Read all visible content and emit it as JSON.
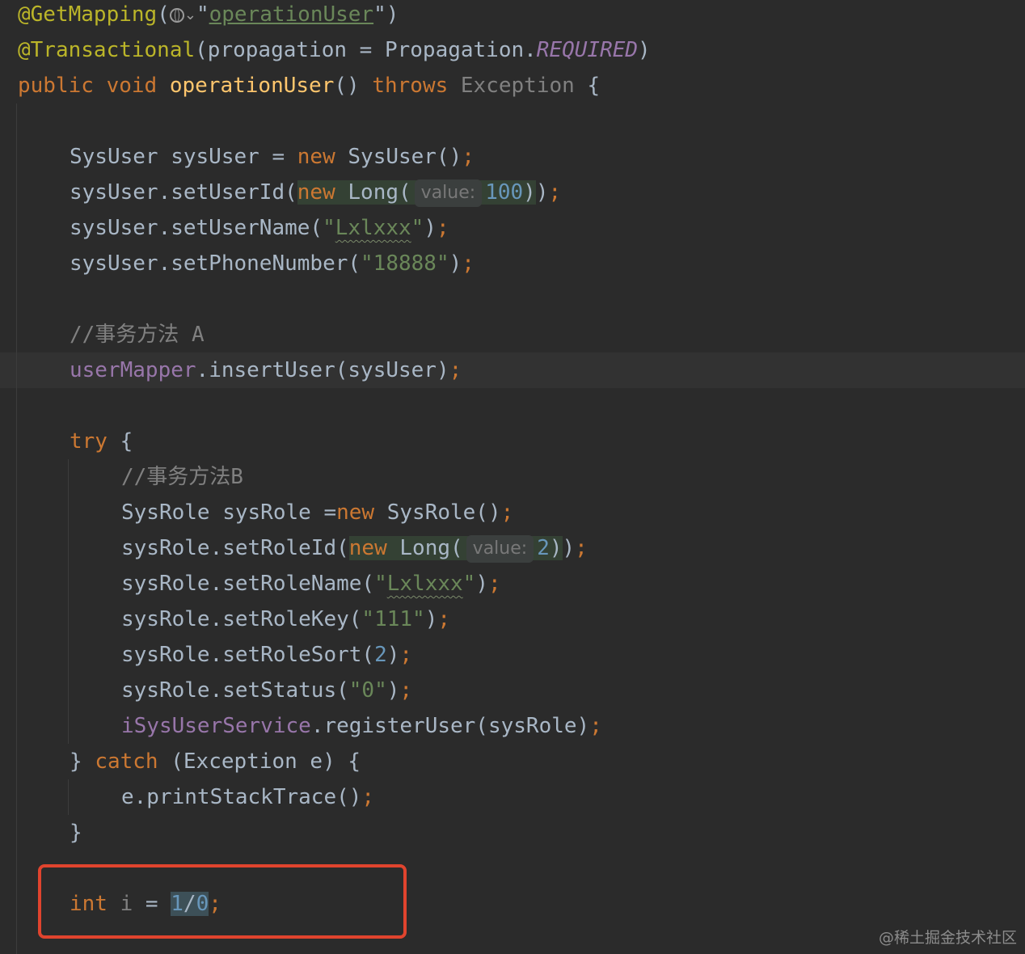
{
  "code": {
    "get_mapping_annotation": "@GetMapping",
    "get_mapping_path": "operationUser",
    "transactional_annotation": "@Transactional",
    "transactional_args": "(propagation = Propagation.",
    "required_constant": "REQUIRED",
    "kw_public": "public",
    "kw_void": "void",
    "method_name": "operationUser",
    "kw_throws": "throws",
    "exception_type": "Exception",
    "sysuser_decl": "SysUser sysUser = ",
    "kw_new": "new",
    "sysuser_ctor": "SysUser()",
    "set_user_id": "sysUser.setUserId(",
    "long_ctor": "Long(",
    "hint_value": "value:",
    "user_id_value": "100",
    "set_user_name": "sysUser.setUserName(",
    "user_name_value": "Lxlxxx",
    "set_phone": "sysUser.setPhoneNumber(",
    "phone_value": "\"18888\"",
    "comment_a": "//事务方法 A",
    "user_mapper": "userMapper",
    "insert_user_call": ".insertUser(sysUser)",
    "kw_try": "try",
    "comment_b": "//事务方法B",
    "sysrole_decl": "SysRole sysRole =",
    "sysrole_ctor": "SysRole()",
    "set_role_id": "sysRole.setRoleId(",
    "role_id_value": "2",
    "set_role_name": "sysRole.setRoleName(",
    "role_name_value": "Lxlxxx",
    "set_role_key": "sysRole.setRoleKey(",
    "role_key_value": "\"111\"",
    "set_role_sort": "sysRole.setRoleSort(",
    "role_sort_value": "2",
    "set_status": "sysRole.setStatus(",
    "status_value": "\"0\"",
    "service_field": "iSysUserService",
    "register_call": ".registerUser(sysRole)",
    "kw_catch": "catch",
    "catch_args": "(Exception e) {",
    "print_stack": "e.printStackTrace()",
    "kw_int": "int",
    "var_i": "i",
    "div_one": "1",
    "div_slash": "/",
    "div_zero": "0"
  },
  "watermark": "@稀土掘金技术社区",
  "colors": {
    "background": "#2b2b2b",
    "keyword": "#cc7832",
    "string": "#6a8759",
    "number": "#6897bb",
    "annotation": "#bbb529",
    "method_decl": "#ffc66d",
    "field": "#9876aa",
    "comment": "#808080",
    "highlight_box": "#e0442e"
  },
  "icons": [
    "globe-icon",
    "chevron-down-icon"
  ]
}
